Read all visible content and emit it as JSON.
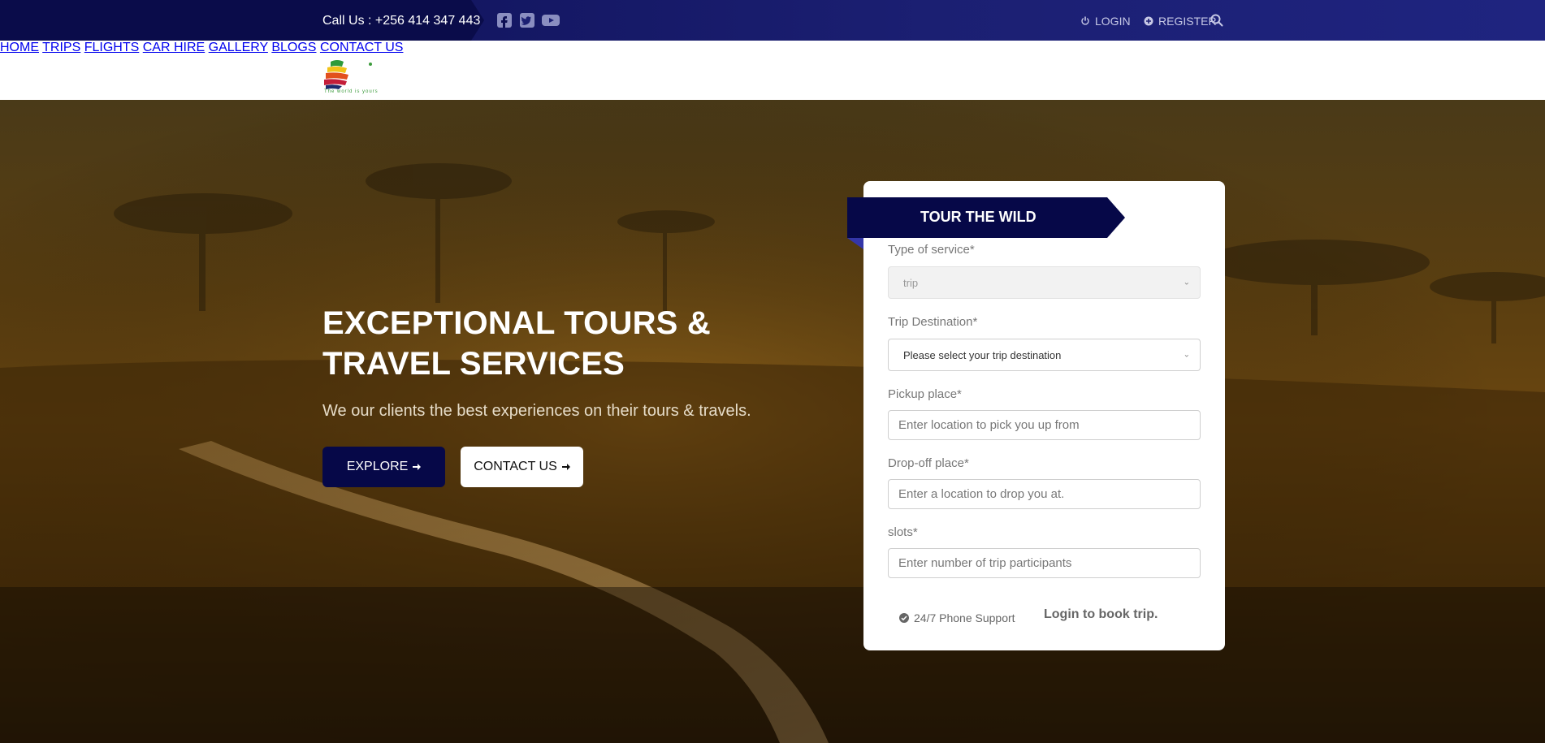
{
  "topbar": {
    "phone": "Call Us : +256 414 347 443",
    "social": [
      "facebook-icon",
      "twitter-icon",
      "youtube-icon"
    ],
    "login": "LOGIN",
    "register": "REGISTER"
  },
  "brand": {
    "tagline": "The world is yours"
  },
  "nav": {
    "items": [
      "HOME",
      "TRIPS",
      "FLIGHTS",
      "CAR HIRE",
      "GALLERY",
      "BLOGS",
      "CONTACT US"
    ]
  },
  "hero": {
    "title": "EXCEPTIONAL TOURS & TRAVEL SERVICES",
    "subtitle": "We our clients the best experiences on their tours & travels.",
    "explore_label": "EXPLORE",
    "contact_label": "CONTACT US"
  },
  "booking": {
    "ribbon": "TOUR THE WILD",
    "service_label": "Type of service*",
    "service_value": "trip",
    "destination_label": "Trip Destination*",
    "destination_value": "Please select your trip destination",
    "pickup_label": "Pickup place*",
    "pickup_placeholder": "Enter location to pick you up from",
    "dropoff_label": "Drop-off place*",
    "dropoff_placeholder": "Enter a location to drop you at.",
    "slots_label": "slots*",
    "slots_placeholder": "Enter number of trip participants",
    "support": "24/7 Phone Support",
    "login_to_book": "Login to book trip."
  },
  "colors": {
    "primary": "#060848",
    "topbar": "#1b1f72",
    "accent_green": "#3c9b3c"
  }
}
